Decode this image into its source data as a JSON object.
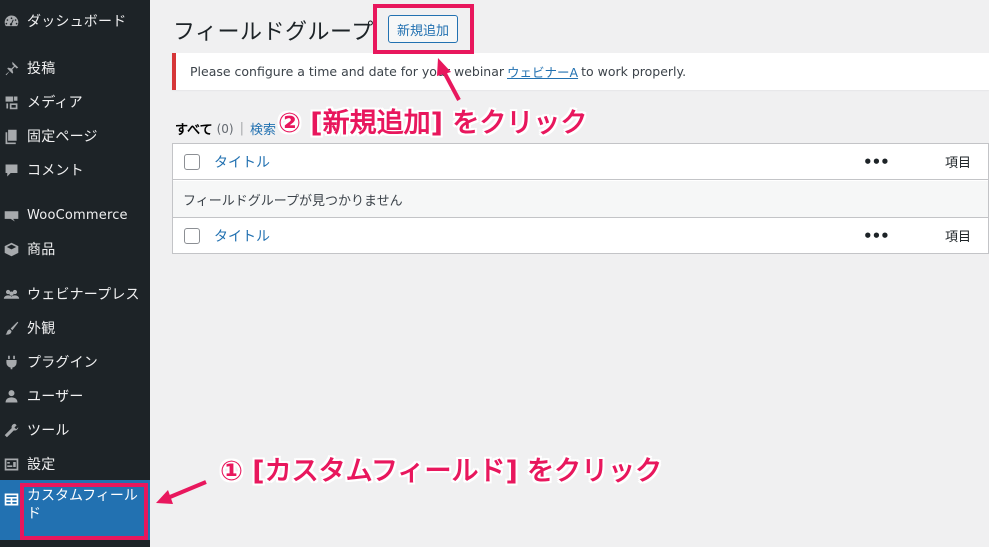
{
  "sidebar": {
    "items": [
      {
        "label": "ダッシュボード",
        "icon": "dashboard-icon"
      },
      {
        "label": "投稿",
        "icon": "pin-icon"
      },
      {
        "label": "メディア",
        "icon": "media-icon"
      },
      {
        "label": "固定ページ",
        "icon": "page-icon"
      },
      {
        "label": "コメント",
        "icon": "comment-icon"
      },
      {
        "label": "WooCommerce",
        "icon": "woocommerce-icon"
      },
      {
        "label": "商品",
        "icon": "box-icon"
      },
      {
        "label": "ウェビナープレス",
        "icon": "people-icon"
      },
      {
        "label": "外観",
        "icon": "brush-icon"
      },
      {
        "label": "プラグイン",
        "icon": "plugin-icon"
      },
      {
        "label": "ユーザー",
        "icon": "user-icon"
      },
      {
        "label": "ツール",
        "icon": "wrench-icon"
      },
      {
        "label": "設定",
        "icon": "settings-icon"
      }
    ],
    "active_item": {
      "label": "カスタムフィールド",
      "icon": "custom-fields-icon"
    }
  },
  "header": {
    "title": "フィールドグループ",
    "add_new_label": "新規追加"
  },
  "notice": {
    "text_before": "Please configure a time and date for your webinar",
    "link_text": "ウェビナーA",
    "text_after": "to work properly."
  },
  "filters": {
    "all_label": "すべて",
    "all_count": "(0)",
    "separator": "|",
    "search_label": "検索"
  },
  "table": {
    "columns": {
      "title": "タイトル",
      "more": "•••",
      "item": "項目"
    },
    "empty_message": "フィールドグループが見つかりません"
  },
  "annotations": {
    "step1": "① [カスタムフィールド] をクリック",
    "step2": "② [新規追加] をクリック"
  },
  "colors": {
    "accent": "#e8175d",
    "sidebar_bg": "#1d2327",
    "active_bg": "#2271b1",
    "link": "#2271b1",
    "notice_border": "#d63638"
  }
}
